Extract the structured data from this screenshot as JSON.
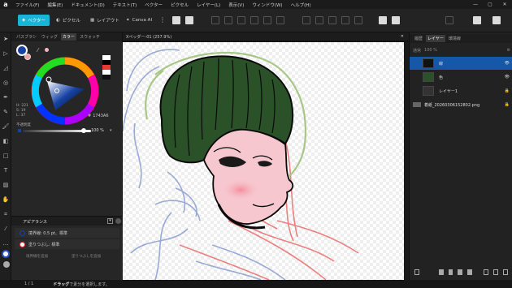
{
  "menubar": {
    "logo": "a",
    "items": [
      "ファイル(F)",
      "編集(E)",
      "ドキュメント(D)",
      "テキスト(T)",
      "ベクター",
      "ピクセル",
      "レイヤー(L)",
      "表示(V)",
      "ウィンドウ(W)",
      "ヘルプ(H)"
    ],
    "win": [
      "—",
      "▢",
      "✕"
    ]
  },
  "toolbar": {
    "modes": [
      "ベクター",
      "ピクセル",
      "レイアウト",
      "Canva AI"
    ],
    "accent": "#17b6d6"
  },
  "colorpanel": {
    "tabs": [
      "パスブラシ",
      "ウィッグ",
      "カラー",
      "スウォッチ"
    ],
    "hsl": [
      "H: 221",
      "S: 19",
      "L: 37"
    ],
    "hex": "1743A6",
    "opacity_label": "不透明度",
    "opacity_value": "100 %"
  },
  "doc": {
    "tab": "Xペッダー-01 (257.9%)",
    "close": "✕"
  },
  "layers": {
    "tabs": [
      "履歴",
      "レイヤー",
      "環境線"
    ],
    "blend": "通常",
    "opacity": "100 %",
    "rows": [
      {
        "name": "線",
        "selected": true
      },
      {
        "name": "色"
      },
      {
        "name": "レイヤー1"
      },
      {
        "name": "着紙_20260306152802.png"
      }
    ]
  },
  "appearance": {
    "title": "アピアランス",
    "items": [
      "境界線: 0.5 pt、標準",
      "塗りつぶし: 標準"
    ],
    "add_stroke": "境界線を追加",
    "add_fill": "塗りつぶしを追加"
  },
  "status": {
    "page": "1 / 1",
    "hint_bold": "ドラッグ",
    "hint": "で素分を選択します。"
  }
}
